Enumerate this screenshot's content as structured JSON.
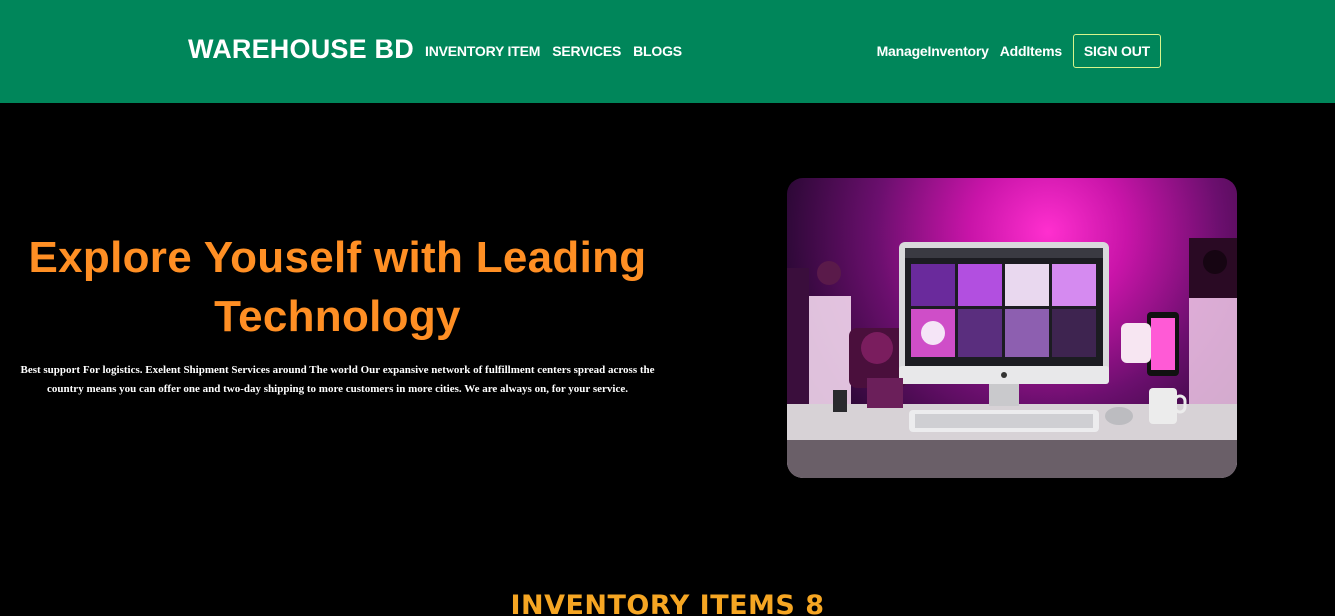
{
  "navbar": {
    "brand": "WAREHOUSE BD",
    "left_links": [
      "INVENTORY ITEM",
      "SERVICES",
      "BLOGS"
    ],
    "right_links": [
      "ManageInventory",
      "AddItems"
    ],
    "signout_label": "SIGN OUT",
    "background_color": "#00865a"
  },
  "hero": {
    "title": "Explore Youself with Leading Technology",
    "description": "Best support For logistics. Exelent Shipment Services around The world Our expansive network of fulfillment centers spread across the country means you can offer one and two-day shipping to more customers in more cities. We are always on, for your service.",
    "title_color": "#ff8f24",
    "image_subject": "desktop computer on a desk lit with pink and purple neon lighting"
  },
  "inventory_section": {
    "heading": "INVENTORY ITEMS 8",
    "heading_color": "#f6a623"
  }
}
